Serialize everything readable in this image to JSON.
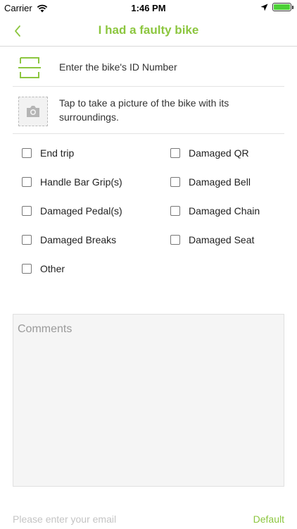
{
  "status_bar": {
    "carrier": "Carrier",
    "time": "1:46 PM"
  },
  "nav": {
    "title": "I had a faulty bike",
    "back_icon": "chevron-left-icon"
  },
  "bike_id": {
    "label": "Enter the bike's ID Number",
    "icon": "scan-icon"
  },
  "photo": {
    "label": "Tap to take a picture of the bike with its surroundings.",
    "icon": "camera-icon"
  },
  "issues": [
    {
      "label": "End trip",
      "checked": false
    },
    {
      "label": "Damaged QR",
      "checked": false
    },
    {
      "label": "Handle Bar Grip(s)",
      "checked": false
    },
    {
      "label": "Damaged Bell",
      "checked": false
    },
    {
      "label": "Damaged Pedal(s)",
      "checked": false
    },
    {
      "label": "Damaged Chain",
      "checked": false
    },
    {
      "label": "Damaged Breaks",
      "checked": false
    },
    {
      "label": "Damaged Seat",
      "checked": false
    },
    {
      "label": "Other",
      "checked": false
    }
  ],
  "comments": {
    "placeholder": "Comments"
  },
  "email": {
    "placeholder": "Please enter your email",
    "default_label": "Default"
  },
  "colors": {
    "accent": "#8cc63f",
    "battery": "#4cd137"
  }
}
